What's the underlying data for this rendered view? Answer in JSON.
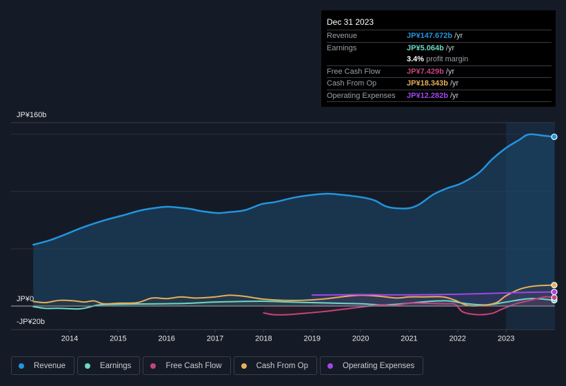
{
  "tooltip": {
    "date": "Dec 31 2023",
    "rows": [
      {
        "label": "Revenue",
        "value": "JP¥147.672b",
        "suffix": " /yr",
        "color": "#2394df"
      },
      {
        "label": "Earnings",
        "value": "JP¥5.064b",
        "suffix": " /yr",
        "color": "#6cd9c6"
      },
      {
        "label": "",
        "value": "3.4%",
        "suffix": " profit margin",
        "color": "#ffffff"
      },
      {
        "label": "Free Cash Flow",
        "value": "JP¥7.429b",
        "suffix": " /yr",
        "color": "#c5447f"
      },
      {
        "label": "Cash From Op",
        "value": "JP¥18.343b",
        "suffix": " /yr",
        "color": "#e8ae5c"
      },
      {
        "label": "Operating Expenses",
        "value": "JP¥12.282b",
        "suffix": " /yr",
        "color": "#a246e6"
      }
    ]
  },
  "legend": [
    {
      "label": "Revenue",
      "color": "#2394df"
    },
    {
      "label": "Earnings",
      "color": "#6cd9c6"
    },
    {
      "label": "Free Cash Flow",
      "color": "#c5447f"
    },
    {
      "label": "Cash From Op",
      "color": "#e8ae5c"
    },
    {
      "label": "Operating Expenses",
      "color": "#a246e6"
    }
  ],
  "chart_data": {
    "type": "area",
    "title": "",
    "xlabel": "",
    "ylabel": "",
    "y_tick_labels": [
      {
        "value": 160,
        "label": "JP¥160b"
      },
      {
        "value": 0,
        "label": "JP¥0"
      },
      {
        "value": -20,
        "label": "-JP¥20b"
      }
    ],
    "gridlines": [
      50,
      100,
      150
    ],
    "ylim": [
      -20,
      160
    ],
    "xlim": [
      2013.25,
      2024.0
    ],
    "x_ticks": [
      2014,
      2015,
      2016,
      2017,
      2018,
      2019,
      2020,
      2021,
      2022,
      2023
    ],
    "highlight_from": 2023.0,
    "legend_position": "bottom",
    "series": [
      {
        "name": "Revenue",
        "color": "#2394df",
        "x": [
          2013.25,
          2013.56,
          2013.91,
          2014.27,
          2014.7,
          2015.12,
          2015.48,
          2015.84,
          2016.05,
          2016.48,
          2016.69,
          2017.04,
          2017.25,
          2017.61,
          2017.96,
          2018.24,
          2018.67,
          2019.09,
          2019.37,
          2019.8,
          2020.09,
          2020.3,
          2020.51,
          2020.72,
          2021.0,
          2021.22,
          2021.5,
          2021.79,
          2022.07,
          2022.43,
          2022.71,
          2023.0,
          2023.27,
          2023.47,
          2023.78,
          2024.0
        ],
        "values": [
          53.5,
          57,
          62.5,
          68.6,
          74.6,
          79.4,
          83.6,
          86,
          86.6,
          84.8,
          83,
          81.2,
          81.8,
          83.6,
          89,
          90.8,
          95,
          97.4,
          98,
          96.2,
          94.4,
          92,
          87.2,
          85.4,
          85.4,
          89,
          97.4,
          102.9,
          107,
          116,
          128,
          138,
          145,
          149.8,
          148.6,
          147.7
        ]
      },
      {
        "name": "Earnings",
        "color": "#6cd9c6",
        "x": [
          2013.25,
          2013.5,
          2013.8,
          2014.2,
          2014.4,
          2014.6,
          2015.0,
          2015.5,
          2016.0,
          2016.5,
          2017.0,
          2017.5,
          2018.0,
          2018.5,
          2019.0,
          2019.5,
          2020.0,
          2020.5,
          2021.0,
          2021.4,
          2021.8,
          2022.2,
          2022.6,
          2023.0,
          2023.5,
          2024.0
        ],
        "values": [
          -0.5,
          -2,
          -2,
          -2.5,
          -1,
          1,
          1.5,
          1.8,
          2,
          2.5,
          3.5,
          4,
          4.2,
          3.5,
          3,
          2.5,
          2,
          1,
          2.5,
          4,
          4.5,
          2,
          1,
          3.5,
          6.5,
          5.1
        ]
      },
      {
        "name": "Free Cash Flow",
        "color": "#c5447f",
        "x": [
          2018.0,
          2018.2,
          2018.5,
          2018.8,
          2019.2,
          2019.6,
          2020.0,
          2020.4,
          2020.7,
          2021.0,
          2021.3,
          2021.7,
          2021.95,
          2022.1,
          2022.4,
          2022.7,
          2022.9,
          2023.2,
          2023.5,
          2023.8,
          2024.0
        ],
        "values": [
          -6,
          -7.5,
          -7.5,
          -6.5,
          -5,
          -3,
          -1,
          1,
          0.5,
          2.5,
          2.5,
          2,
          1.5,
          -5,
          -7.5,
          -6.5,
          -3,
          2,
          5,
          8,
          7.4
        ]
      },
      {
        "name": "Cash From Op",
        "color": "#e8ae5c",
        "x": [
          2013.25,
          2013.5,
          2013.8,
          2014.1,
          2014.3,
          2014.5,
          2014.7,
          2015.0,
          2015.4,
          2015.7,
          2016.0,
          2016.3,
          2016.6,
          2017.0,
          2017.3,
          2017.6,
          2018.0,
          2018.4,
          2018.8,
          2019.2,
          2019.6,
          2020.0,
          2020.4,
          2020.75,
          2021.0,
          2021.3,
          2021.7,
          2021.95,
          2022.2,
          2022.5,
          2022.8,
          2023.0,
          2023.3,
          2023.6,
          2024.0
        ],
        "values": [
          4,
          3,
          5,
          4.5,
          3.5,
          4.5,
          2,
          2.5,
          3,
          7,
          6.5,
          8,
          7,
          8,
          9.5,
          8.5,
          6,
          5,
          5,
          6,
          8,
          9.5,
          8.5,
          7,
          8,
          8,
          8,
          5,
          0.5,
          0.5,
          3,
          9,
          15,
          17.5,
          18.3
        ]
      },
      {
        "name": "Operating Expenses",
        "color": "#a246e6",
        "x": [
          2019.0,
          2019.5,
          2020.0,
          2020.5,
          2021.0,
          2021.5,
          2022.0,
          2022.5,
          2023.0,
          2023.5,
          2024.0
        ],
        "values": [
          9.6,
          9.8,
          10,
          9.8,
          9.8,
          10,
          10.3,
          10.8,
          11.5,
          12,
          12.3
        ]
      }
    ]
  }
}
